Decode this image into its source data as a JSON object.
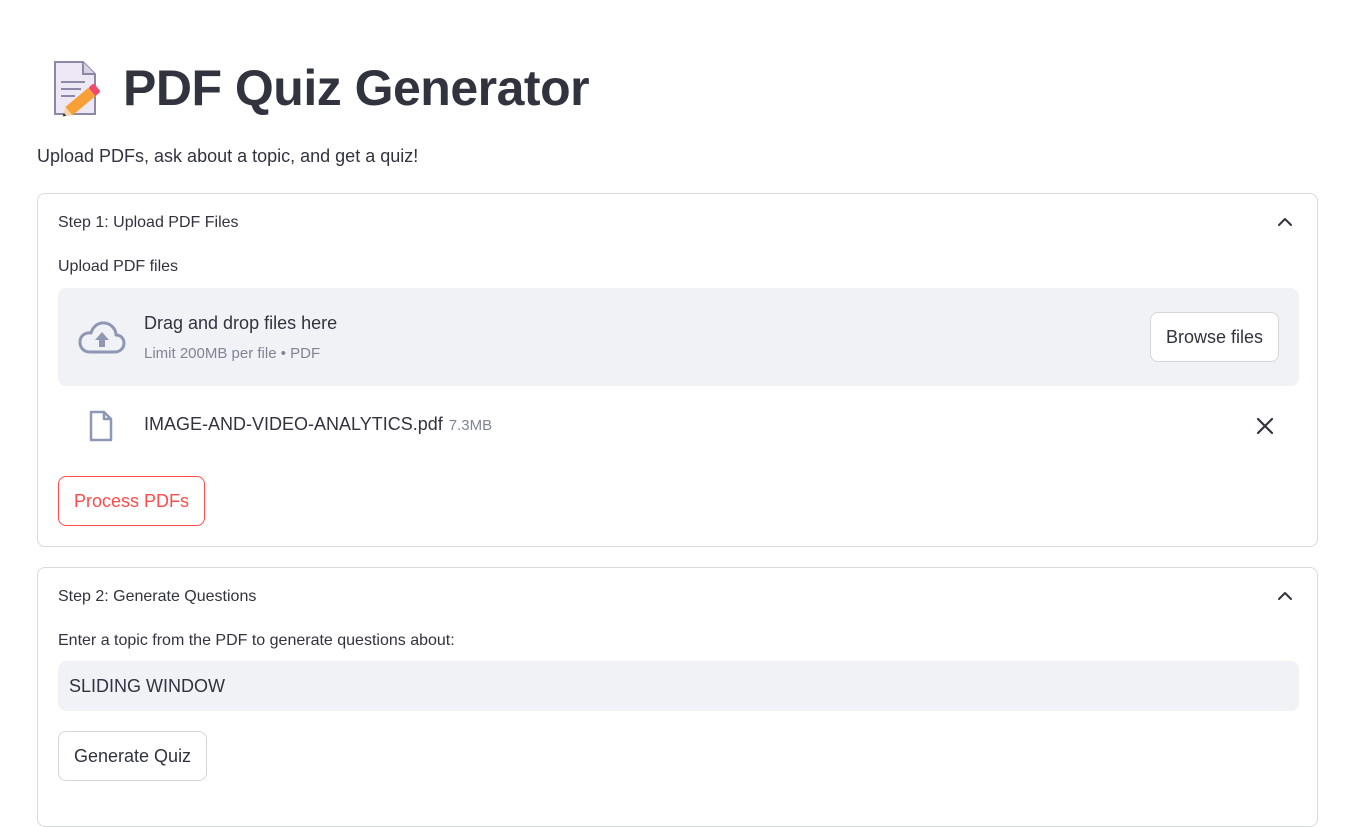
{
  "header": {
    "title_icon": "memo-pencil-icon",
    "title": "PDF Quiz Generator",
    "subtitle": "Upload PDFs, ask about a topic, and get a quiz!"
  },
  "step1": {
    "header": "Step 1: Upload PDF Files",
    "upload_label": "Upload PDF files",
    "dropzone_main": "Drag and drop files here",
    "dropzone_sub": "Limit 200MB per file • PDF",
    "browse_label": "Browse files",
    "file": {
      "name": "IMAGE-AND-VIDEO-ANALYTICS.pdf",
      "size": "7.3MB"
    },
    "process_label": "Process PDFs"
  },
  "step2": {
    "header": "Step 2: Generate Questions",
    "topic_label": "Enter a topic from the PDF to generate questions about:",
    "topic_value": "SLIDING WINDOW",
    "generate_label": "Generate Quiz"
  },
  "colors": {
    "text": "#31333f",
    "muted": "#808495",
    "accent": "#ff4b4b",
    "field_bg": "#f0f2f6",
    "border": "#d9dadf"
  }
}
